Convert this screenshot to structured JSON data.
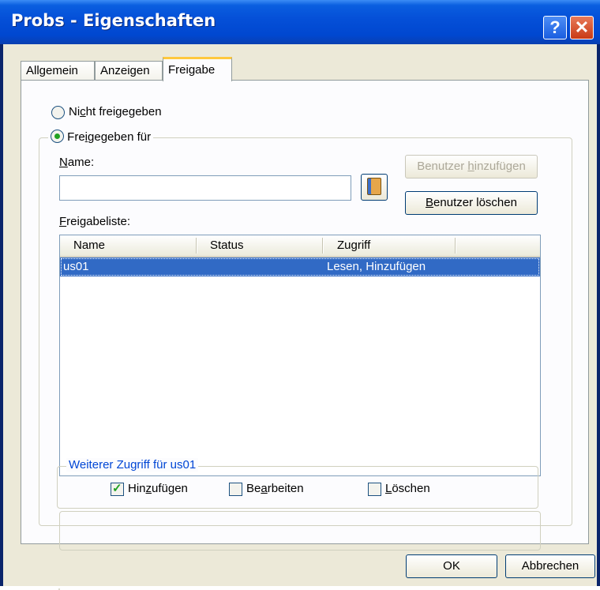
{
  "window": {
    "title": "Probs - Eigenschaften",
    "help_glyph": "?",
    "close_glyph": "✕"
  },
  "tabs": [
    {
      "label": "Allgemein"
    },
    {
      "label": "Anzeigen"
    },
    {
      "label": "Freigabe"
    }
  ],
  "sharing": {
    "not_shared": {
      "pre": "Ni",
      "ul": "c",
      "post": "ht freigegeben",
      "selected": false
    },
    "shared_for": {
      "pre": "Fre",
      "ul": "i",
      "post": "gegeben für",
      "selected": true
    },
    "name_label": {
      "ul": "N",
      "post": "ame:"
    },
    "name_value": "",
    "address_book_icon": "address-book-icon",
    "add_user_button": {
      "pre": "Benutzer ",
      "ul": "h",
      "post": "inzufügen",
      "enabled": false
    },
    "delete_user_button": {
      "ul": "B",
      "post": "enutzer löschen"
    },
    "share_list_label": {
      "ul": "F",
      "post": "reigabeliste:"
    },
    "columns": [
      "Name",
      "Status",
      "Zugriff"
    ],
    "rows": [
      {
        "name": "us01",
        "status": "",
        "access": "Lesen, Hinzufügen"
      }
    ],
    "further_access": {
      "legend": "Weiterer Zugriff für us01",
      "add": {
        "pre": "Hin",
        "ul": "z",
        "post": "ufügen",
        "checked": true
      },
      "edit": {
        "pre": "Be",
        "ul": "a",
        "post": "rbeiten",
        "checked": false
      },
      "delete": {
        "pre": "",
        "ul": "L",
        "post": "öschen",
        "checked": false
      }
    }
  },
  "footer": {
    "ok": "OK",
    "cancel": "Abbrechen"
  },
  "colors": {
    "selection": "#316ac5",
    "legend": "#0046d5",
    "dialog_bg": "#ece9d8"
  }
}
